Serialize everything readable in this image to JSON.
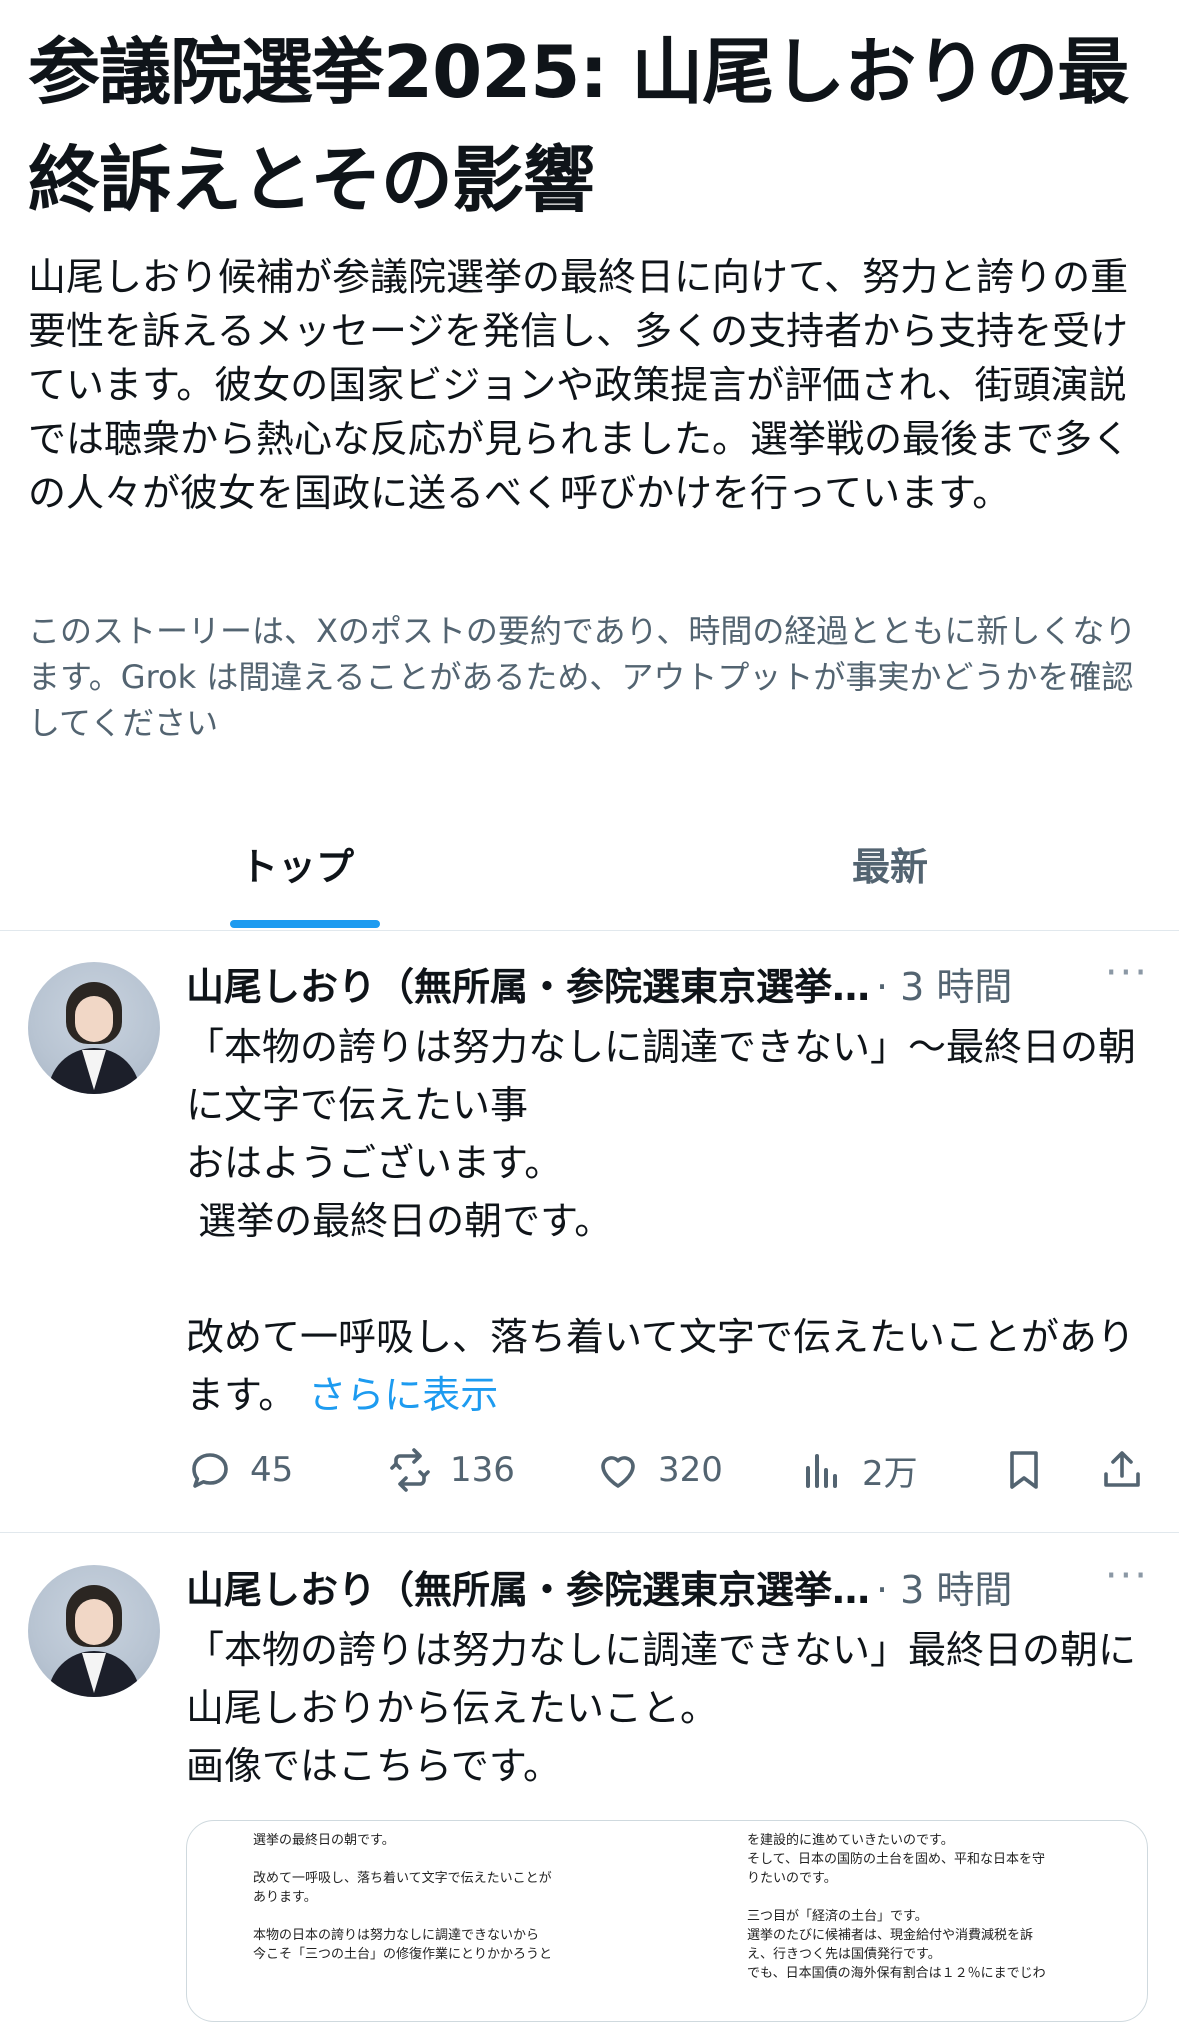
{
  "story": {
    "title": "参議院選挙2025: 山尾しおりの最終訴えとその影響",
    "summary": "山尾しおり候補が参議院選挙の最終日に向けて、努力と誇りの重要性を訴えるメッセージを発信し、多くの支持者から支持を受けています。彼女の国家ビジョンや政策提言が評価され、街頭演説では聴衆から熱心な反応が見られました。選挙戦の最後まで多くの人々が彼女を国政に送るべく呼びかけを行っています。",
    "disclaimer": "このストーリーは、Xのポストの要約であり、時間の経過とともに新しくなります。Grok は間違えることがあるため、アウトプットが事実かどうかを確認してください"
  },
  "tabs": [
    {
      "label": "トップ",
      "active": true
    },
    {
      "label": "最新",
      "active": false
    }
  ],
  "posts": [
    {
      "author": "山尾しおり（無所属・参院選東京選挙…",
      "time": "· 3 時間",
      "more": "···",
      "text": "「本物の誇りは努力なしに調達できない」〜最終日の朝に文字で伝えたい事\nおはようございます。\n 選挙の最終日の朝です。\n\n改めて一呼吸し、落ち着いて文字で伝えたいことがあります。 ",
      "show_more": "さらに表示",
      "stats": {
        "replies": "45",
        "reposts": "136",
        "likes": "320",
        "views": "2万"
      }
    },
    {
      "author": "山尾しおり（無所属・参院選東京選挙…",
      "time": "· 3 時間",
      "more": "···",
      "text": "「本物の誇りは努力なしに調達できない」最終日の朝に山尾しおりから伝えたいこと。\n画像ではこちらです。",
      "image_left": "選挙の最終日の朝です。\n\n改めて一呼吸し、落ち着いて文字で伝えたいことが\nあります。\n\n本物の日本の誇りは努力なしに調達できないから\n今こそ「三つの土台」の修復作業にとりかかろうと",
      "image_right": "を建設的に進めていきたいのです。\nそして、日本の国防の土台を固め、平和な日本を守\nりたいのです。\n\n三つ目が「経済の土台」です。\n選挙のたびに候補者は、現金給付や消費減税を訴\nえ、行きつく先は国債発行です。\nでも、日本国債の海外保有割合は１２％にまでじわ"
    }
  ],
  "colors": {
    "accent": "#1d9bf0",
    "text": "#0f1419",
    "muted": "#536471",
    "divider": "#e1e8ed"
  }
}
